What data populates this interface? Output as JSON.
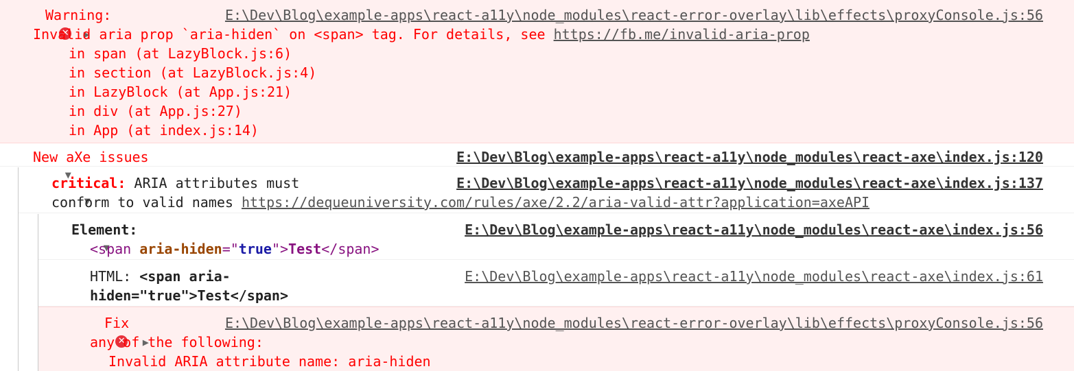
{
  "warning": {
    "label": "Warning:",
    "source": "E:\\Dev\\Blog\\example-apps\\react-a11y\\node_modules\\react-error-overlay\\lib\\effects\\proxyConsole.js:56",
    "message": "Invalid aria prop `aria-hiden` on <span> tag. For details, see ",
    "link": "https://fb.me/invalid-aria-prop",
    "stack": [
      "in span (at LazyBlock.js:6)",
      "in section (at LazyBlock.js:4)",
      "in LazyBlock (at App.js:21)",
      "in div (at App.js:27)",
      "in App (at index.js:14)"
    ]
  },
  "axe_group": {
    "title": "New aXe issues",
    "source": "E:\\Dev\\Blog\\example-apps\\react-a11y\\node_modules\\react-axe\\index.js:120"
  },
  "critical": {
    "label": "critical:",
    "text_line1": " ARIA attributes must",
    "text_line2": "conform to valid names ",
    "link": "https://dequeuniversity.com/rules/axe/2.2/aria-valid-attr?application=axeAPI",
    "source": "E:\\Dev\\Blog\\example-apps\\react-a11y\\node_modules\\react-axe\\index.js:137"
  },
  "element": {
    "label": "Element:",
    "source": "E:\\Dev\\Blog\\example-apps\\react-a11y\\node_modules\\react-axe\\index.js:56",
    "node": {
      "open_lt": "<",
      "tag": "span",
      "attr_name": "aria-hiden",
      "eq": "=\"",
      "attr_value": "true",
      "close_q": "\">",
      "content": "Test",
      "close_lt": "</",
      "close_tag": "span",
      "close_gt": ">"
    }
  },
  "html_row": {
    "label": "HTML: ",
    "value_line1": "<span aria-",
    "value_line2": "hiden=\"true\">Test</span>",
    "source": "E:\\Dev\\Blog\\example-apps\\react-a11y\\node_modules\\react-axe\\index.js:61"
  },
  "fix": {
    "label": "Fix",
    "source": "E:\\Dev\\Blog\\example-apps\\react-a11y\\node_modules\\react-error-overlay\\lib\\effects\\proxyConsole.js:56",
    "line2": "any of the following:",
    "line3": "Invalid ARIA attribute name: aria-hiden"
  },
  "icons": {
    "error": "error-circle-icon",
    "expand_collapsed": "triangle-right-icon",
    "expand_open": "triangle-down-icon"
  },
  "colors": {
    "error_bg": "#fff0f0",
    "error_text": "#ff0000",
    "source_link": "#545454"
  }
}
